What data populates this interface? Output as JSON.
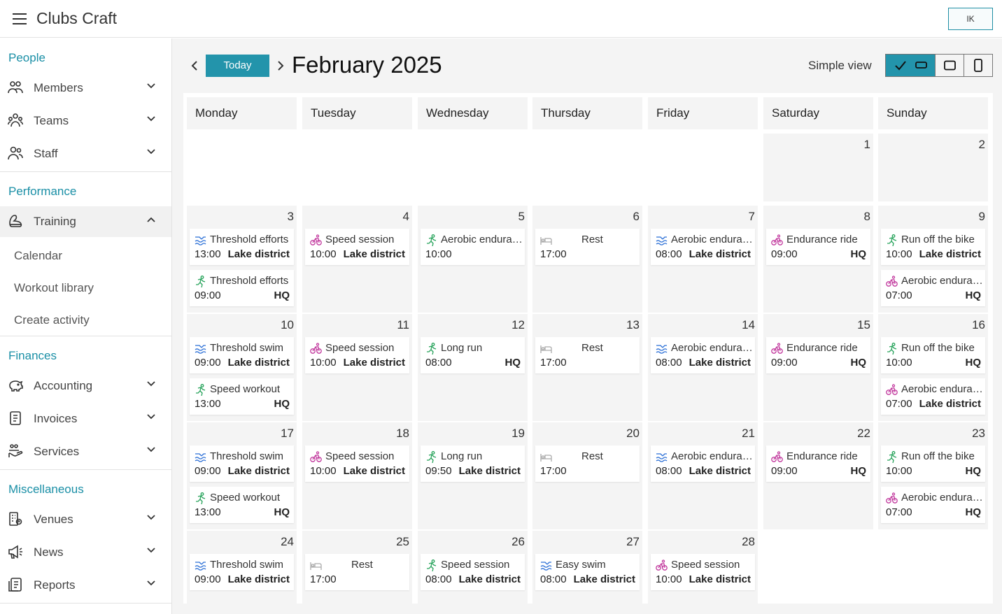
{
  "app": {
    "title": "Clubs Craft",
    "user_initials": "IK"
  },
  "sidebar": {
    "people_title": "People",
    "people": [
      "Members",
      "Teams",
      "Staff"
    ],
    "performance_title": "Performance",
    "training_label": "Training",
    "training_sub": [
      "Calendar",
      "Workout library",
      "Create activity"
    ],
    "finances_title": "Finances",
    "finances": [
      "Accounting",
      "Invoices",
      "Services"
    ],
    "misc_title": "Miscellaneous",
    "misc": [
      "Venues",
      "News",
      "Reports"
    ]
  },
  "toolbar": {
    "today_label": "Today",
    "month_title": "February 2025",
    "view_label": "Simple view"
  },
  "colors": {
    "accent": "#2394ab",
    "swim": "#2b6fd6",
    "run": "#27a35b",
    "bike": "#c23a9e",
    "rest": "#aaaaaa"
  },
  "weekdays": [
    "Monday",
    "Tuesday",
    "Wednesday",
    "Thursday",
    "Friday",
    "Saturday",
    "Sunday"
  ],
  "days": [
    {
      "n": "1",
      "ev": []
    },
    {
      "n": "2",
      "ev": []
    },
    {
      "n": "3",
      "ev": [
        {
          "type": "swim",
          "title": "Threshold efforts",
          "time": "13:00",
          "loc": "Lake district"
        },
        {
          "type": "run",
          "title": "Threshold efforts",
          "time": "09:00",
          "loc": "HQ"
        }
      ]
    },
    {
      "n": "4",
      "ev": [
        {
          "type": "bike",
          "title": "Speed session",
          "time": "10:00",
          "loc": "Lake district"
        }
      ]
    },
    {
      "n": "5",
      "ev": [
        {
          "type": "run",
          "title": "Aerobic endurance",
          "time": "10:00",
          "loc": ""
        }
      ]
    },
    {
      "n": "6",
      "ev": [
        {
          "type": "rest",
          "title": "Rest",
          "time": "17:00",
          "loc": ""
        }
      ]
    },
    {
      "n": "7",
      "ev": [
        {
          "type": "swim",
          "title": "Aerobic endurance",
          "time": "08:00",
          "loc": "Lake district"
        }
      ]
    },
    {
      "n": "8",
      "ev": [
        {
          "type": "bike",
          "title": "Endurance ride",
          "time": "09:00",
          "loc": "HQ"
        }
      ]
    },
    {
      "n": "9",
      "ev": [
        {
          "type": "run",
          "title": "Run off the bike",
          "time": "10:00",
          "loc": "Lake district"
        },
        {
          "type": "bike",
          "title": "Aerobic endurance",
          "time": "07:00",
          "loc": "HQ"
        }
      ]
    },
    {
      "n": "10",
      "ev": [
        {
          "type": "swim",
          "title": "Threshold swim",
          "time": "09:00",
          "loc": "Lake district"
        },
        {
          "type": "run",
          "title": "Speed workout",
          "time": "13:00",
          "loc": "HQ"
        }
      ]
    },
    {
      "n": "11",
      "ev": [
        {
          "type": "bike",
          "title": "Speed session",
          "time": "10:00",
          "loc": "Lake district"
        }
      ]
    },
    {
      "n": "12",
      "ev": [
        {
          "type": "run",
          "title": "Long run",
          "time": "08:00",
          "loc": "HQ"
        }
      ]
    },
    {
      "n": "13",
      "ev": [
        {
          "type": "rest",
          "title": "Rest",
          "time": "17:00",
          "loc": ""
        }
      ]
    },
    {
      "n": "14",
      "ev": [
        {
          "type": "swim",
          "title": "Aerobic endurance",
          "time": "08:00",
          "loc": "Lake district"
        }
      ]
    },
    {
      "n": "15",
      "ev": [
        {
          "type": "bike",
          "title": "Endurance ride",
          "time": "09:00",
          "loc": "HQ"
        }
      ]
    },
    {
      "n": "16",
      "ev": [
        {
          "type": "run",
          "title": "Run off the bike",
          "time": "10:00",
          "loc": "HQ"
        },
        {
          "type": "bike",
          "title": "Aerobic endurance",
          "time": "07:00",
          "loc": "Lake district"
        }
      ]
    },
    {
      "n": "17",
      "ev": [
        {
          "type": "swim",
          "title": "Threshold swim",
          "time": "09:00",
          "loc": "Lake district"
        },
        {
          "type": "run",
          "title": "Speed workout",
          "time": "13:00",
          "loc": "HQ"
        }
      ]
    },
    {
      "n": "18",
      "ev": [
        {
          "type": "bike",
          "title": "Speed session",
          "time": "10:00",
          "loc": "Lake district"
        }
      ]
    },
    {
      "n": "19",
      "ev": [
        {
          "type": "run",
          "title": "Long run",
          "time": "09:50",
          "loc": "Lake district"
        }
      ]
    },
    {
      "n": "20",
      "ev": [
        {
          "type": "rest",
          "title": "Rest",
          "time": "17:00",
          "loc": ""
        }
      ]
    },
    {
      "n": "21",
      "ev": [
        {
          "type": "swim",
          "title": "Aerobic endurance",
          "time": "08:00",
          "loc": "Lake district"
        }
      ]
    },
    {
      "n": "22",
      "ev": [
        {
          "type": "bike",
          "title": "Endurance ride",
          "time": "09:00",
          "loc": "HQ"
        }
      ]
    },
    {
      "n": "23",
      "ev": [
        {
          "type": "run",
          "title": "Run off the bike",
          "time": "10:00",
          "loc": "HQ"
        },
        {
          "type": "bike",
          "title": "Aerobic endurance",
          "time": "07:00",
          "loc": "HQ"
        }
      ]
    },
    {
      "n": "24",
      "ev": [
        {
          "type": "swim",
          "title": "Threshold swim",
          "time": "09:00",
          "loc": "Lake district"
        }
      ]
    },
    {
      "n": "25",
      "ev": [
        {
          "type": "rest",
          "title": "Rest",
          "time": "17:00",
          "loc": ""
        }
      ]
    },
    {
      "n": "26",
      "ev": [
        {
          "type": "run",
          "title": "Speed session",
          "time": "08:00",
          "loc": "Lake district"
        }
      ]
    },
    {
      "n": "27",
      "ev": [
        {
          "type": "swim",
          "title": "Easy swim",
          "time": "08:00",
          "loc": "Lake district"
        }
      ]
    },
    {
      "n": "28",
      "ev": [
        {
          "type": "bike",
          "title": "Speed session",
          "time": "10:00",
          "loc": "Lake district"
        }
      ]
    }
  ]
}
